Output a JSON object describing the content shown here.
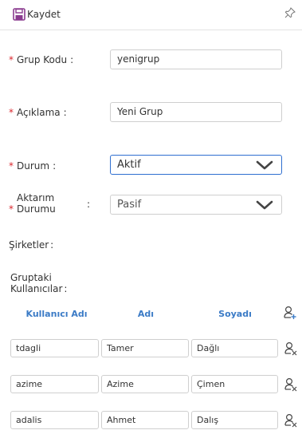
{
  "toolbar": {
    "save_label": "Kaydet",
    "save_icon": "floppy-disk-icon",
    "pin_icon": "pin-icon"
  },
  "form": {
    "required_mark": "*",
    "grup_kodu": {
      "label": "Grup Kodu",
      "colon": ":",
      "value": "yenigrup"
    },
    "aciklama": {
      "label": "Açıklama",
      "colon": ":",
      "value": "Yeni Grup"
    },
    "durum": {
      "label": "Durum",
      "colon": ":",
      "value": "Aktif"
    },
    "aktarim_durumu": {
      "label_line1": "Aktarım",
      "label_line2": "Durumu",
      "colon": ":",
      "value": "Pasif"
    }
  },
  "sirketler": {
    "label": "Şirketler",
    "colon": ":"
  },
  "gruptaki": {
    "label_line1": "Gruptaki",
    "label_line2": "Kullanıcılar",
    "colon": ":"
  },
  "users_table": {
    "headers": {
      "username": "Kullanıcı Adı",
      "name": "Adı",
      "surname": "Soyadı"
    },
    "add_icon": "add-user-icon",
    "remove_icon": "remove-user-icon",
    "rows": [
      {
        "username": "tdagli",
        "name": "Tamer",
        "surname": "Dağlı"
      },
      {
        "username": "azime",
        "name": "Azime",
        "surname": "Çimen"
      },
      {
        "username": "adalis",
        "name": "Ahmet",
        "surname": "Dalış"
      }
    ]
  },
  "colors": {
    "accent": "#3b7bc6",
    "required": "#d9262c",
    "save_icon": "#8a3b8f",
    "focus_border": "#2f6fd0"
  }
}
